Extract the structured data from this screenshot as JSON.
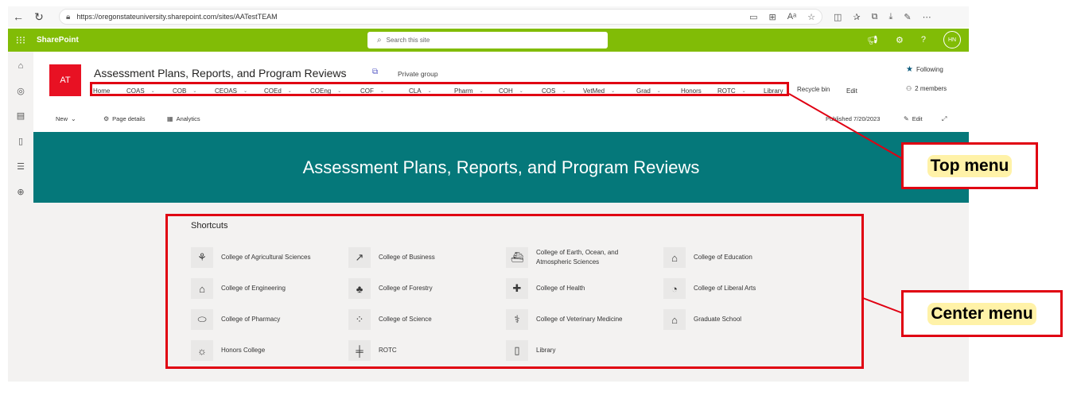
{
  "browser": {
    "url": "https://oregonstateuniversity.sharepoint.com/sites/AATestTEAM"
  },
  "suite": {
    "brand": "SharePoint",
    "search_placeholder": "Search this site",
    "avatar": "HN"
  },
  "site": {
    "logo": "AT",
    "title": "Assessment Plans, Reports, and Program Reviews",
    "group_type": "Private group",
    "following": "Following",
    "members": "2 members",
    "recycle_bin": "Recycle bin",
    "edit": "Edit",
    "top_menu": [
      {
        "label": "Home",
        "chevron": false
      },
      {
        "label": "COAS",
        "chevron": true
      },
      {
        "label": "COB",
        "chevron": true
      },
      {
        "label": "CEOAS",
        "chevron": true
      },
      {
        "label": "COEd",
        "chevron": true
      },
      {
        "label": "COEng",
        "chevron": true
      },
      {
        "label": "COF",
        "chevron": true
      },
      {
        "label": "CLA",
        "chevron": true
      },
      {
        "label": "Pharm",
        "chevron": true
      },
      {
        "label": "COH",
        "chevron": true
      },
      {
        "label": "COS",
        "chevron": true
      },
      {
        "label": "VetMed",
        "chevron": true
      },
      {
        "label": "Grad",
        "chevron": true
      },
      {
        "label": "Honors",
        "chevron": false
      },
      {
        "label": "ROTC",
        "chevron": true
      },
      {
        "label": "Library",
        "chevron": false
      }
    ]
  },
  "command_bar": {
    "new": "New",
    "page_details": "Page details",
    "analytics": "Analytics",
    "published": "Published 7/20/2023",
    "edit": "Edit"
  },
  "banner": {
    "title": "Assessment Plans, Reports, and Program Reviews"
  },
  "shortcuts": {
    "title": "Shortcuts",
    "items": [
      {
        "label": "College of Agricultural Sciences",
        "icon": "plant-icon"
      },
      {
        "label": "College of Business",
        "icon": "chart-up-icon"
      },
      {
        "label": "College of Earth, Ocean, and Atmospheric Sciences",
        "icon": "ship-icon"
      },
      {
        "label": "College of Education",
        "icon": "mortarboard-icon"
      },
      {
        "label": "College of Engineering",
        "icon": "factory-icon"
      },
      {
        "label": "College of Forestry",
        "icon": "tree-icon"
      },
      {
        "label": "College of Health",
        "icon": "health-icon"
      },
      {
        "label": "College of Liberal Arts",
        "icon": "palette-icon"
      },
      {
        "label": "College of Pharmacy",
        "icon": "pill-icon"
      },
      {
        "label": "College of Science",
        "icon": "molecule-icon"
      },
      {
        "label": "College of Veterinary Medicine",
        "icon": "dog-icon"
      },
      {
        "label": "Graduate School",
        "icon": "building-icon"
      },
      {
        "label": "Honors College",
        "icon": "lightbulb-icon"
      },
      {
        "label": "ROTC",
        "icon": "road-icon"
      },
      {
        "label": "Library",
        "icon": "book-icon"
      }
    ]
  },
  "annotations": {
    "top_menu": "Top menu",
    "center_menu": "Center menu",
    "color": "#e00012"
  }
}
